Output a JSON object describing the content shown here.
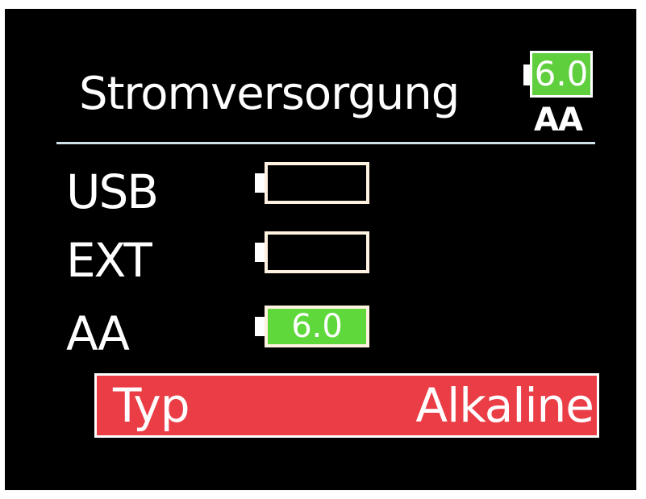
{
  "header": {
    "title": "Stromversorgung",
    "battery_value": "6.0",
    "source": "AA"
  },
  "sources": [
    {
      "label": "USB",
      "value": "",
      "charged": false
    },
    {
      "label": "EXT",
      "value": "",
      "charged": false
    },
    {
      "label": "AA",
      "value": "6.0",
      "charged": true
    }
  ],
  "type_setting": {
    "label": "Typ",
    "value": "Alkaline"
  },
  "colors": {
    "battery_green": "#5fd83c",
    "selection_red": "#ea3d46"
  }
}
